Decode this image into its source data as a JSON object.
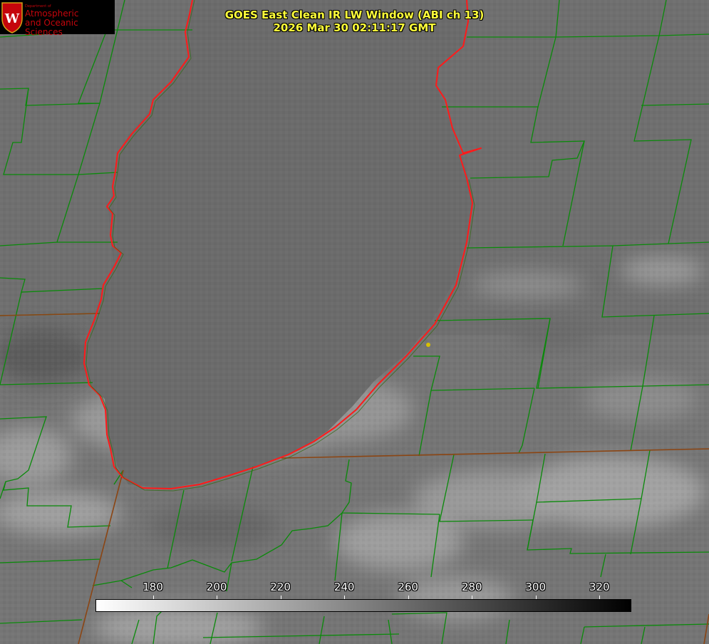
{
  "title": {
    "line1": "GOES East Clean IR LW Window (ABI ch 13)",
    "line2": "2026 Mar 30 02:11:17 GMT"
  },
  "logo": {
    "dept": "Department of",
    "line1": "Atmospheric",
    "line2": "and Oceanic Sciences",
    "crest_letter": "W"
  },
  "colorbar": {
    "ticks": [
      "180",
      "200",
      "220",
      "240",
      "260",
      "280",
      "300",
      "320"
    ],
    "tick_values": [
      180,
      200,
      220,
      240,
      260,
      280,
      300,
      320
    ],
    "range": [
      162,
      330
    ],
    "gradient": [
      "#ffffff",
      "#000000"
    ]
  },
  "colors": {
    "coastline": "#ff1a1a",
    "county_lines": "#0a8a0a",
    "state_lines": "#8b4513",
    "title": "#ffff3a",
    "marker": "#d8c000",
    "lake": "#6a6a6a",
    "land": "#787878"
  }
}
